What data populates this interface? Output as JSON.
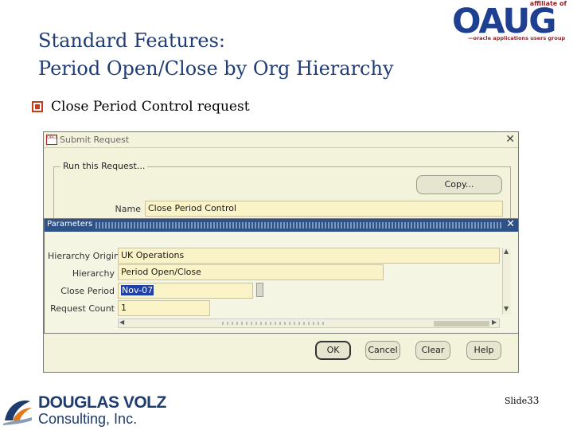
{
  "slide": {
    "title_line1": "Standard Features:",
    "title_line2": "Period Open/Close by Org Hierarchy",
    "bullet": "Close Period Control request",
    "slide_label": "Slide",
    "slide_number": "33"
  },
  "oaug_logo": {
    "affiliate": "affiliate of",
    "wordmark": "OAUG",
    "tagline": "oracle applications users group"
  },
  "company_logo": {
    "name": "DOUGLAS VOLZ",
    "sub": "Consulting, Inc."
  },
  "submit_window": {
    "title": "Submit Request",
    "icon_text": "ORCL",
    "section_legend": "Run this Request...",
    "copy_button": "Copy...",
    "name_label": "Name",
    "name_value": "Close Period Control"
  },
  "parameters_window": {
    "title": "Parameters",
    "fields": [
      {
        "label": "Hierarchy Origin",
        "value": "UK Operations"
      },
      {
        "label": "Hierarchy",
        "value": "Period Open/Close"
      },
      {
        "label": "Close Period",
        "value": "Nov-07"
      },
      {
        "label": "Request Count",
        "value": "1"
      }
    ],
    "buttons": {
      "ok": "OK",
      "cancel": "Cancel",
      "clear": "Clear",
      "help": "Help"
    }
  },
  "colors": {
    "title_blue": "#1f3d74",
    "bullet_orange": "#c43e1c",
    "params_titlebar": "#2e5288",
    "field_yellow": "#fbf3c8"
  },
  "icons": [
    "square-bullet-icon",
    "oracle-forms-icon",
    "close-icon",
    "scroll-up-icon",
    "scroll-down-icon",
    "scroll-left-icon",
    "scroll-right-icon"
  ]
}
